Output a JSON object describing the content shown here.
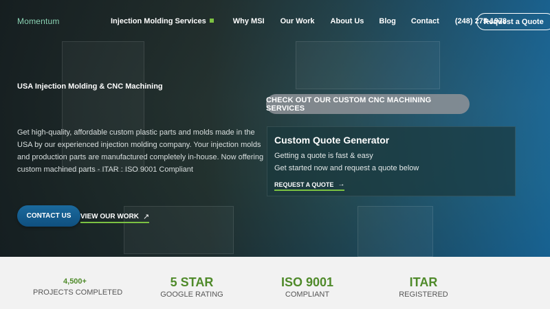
{
  "header": {
    "logo": "Momentum",
    "nav": [
      {
        "label": "Injection Molding Services",
        "has_indicator": true
      },
      {
        "label": "Why MSI"
      },
      {
        "label": "Our Work"
      },
      {
        "label": "About Us"
      },
      {
        "label": "Blog"
      },
      {
        "label": "Contact"
      },
      {
        "label": "(248) 275-1978"
      }
    ],
    "quote_button": "Request a Quote"
  },
  "hero": {
    "eyebrow": "USA Injection Molding & CNC Machining",
    "description": "Get high-quality, affordable custom plastic parts and molds made in the USA by our experienced injection molding company. Your injection molds and production parts are manufactured completely in-house. Now offering custom machined parts - ITAR : ISO 9001 Compliant",
    "contact_button": "CONTACT US",
    "work_link": "VIEW OUR WORK",
    "cnc_button": "CHECK OUT OUR CUSTOM CNC MACHINING SERVICES"
  },
  "quote_generator": {
    "title": "Custom Quote Generator",
    "line1": "Getting a quote is fast & easy",
    "line2": "Get started now and request a quote below",
    "link": "REQUEST A QUOTE"
  },
  "stats": [
    {
      "value": "4,500+",
      "label": "PROJECTS COMPLETED"
    },
    {
      "value": "5 STAR",
      "label": "GOOGLE RATING"
    },
    {
      "value": "ISO 9001",
      "label": "COMPLIANT"
    },
    {
      "value": "ITAR",
      "label": "REGISTERED"
    }
  ],
  "colors": {
    "accent_green": "#7cc242",
    "stat_green": "#4f8a2a",
    "button_blue": "#1b6a9e"
  }
}
